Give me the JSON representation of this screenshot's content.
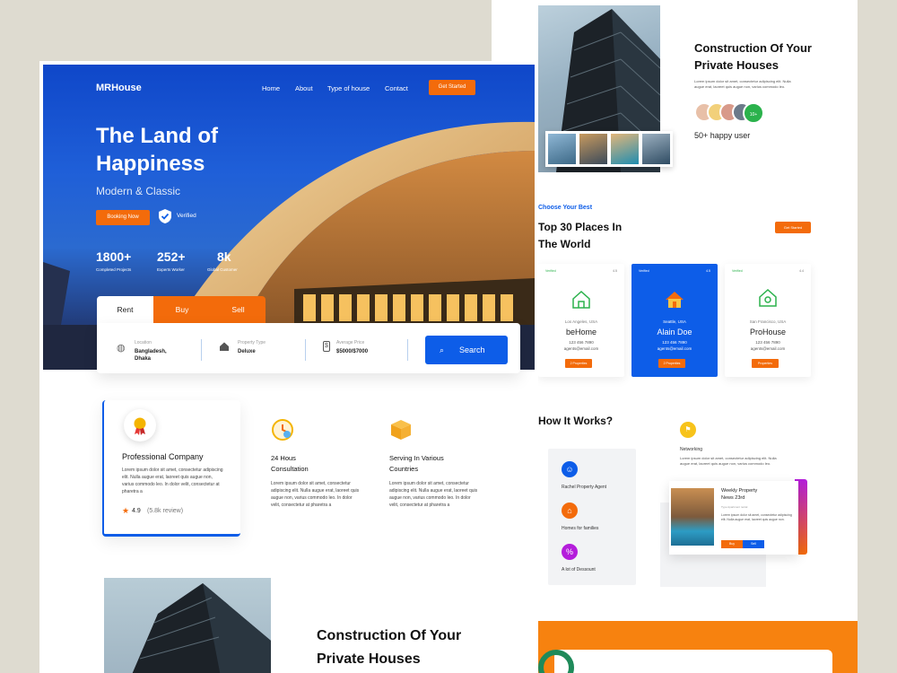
{
  "nav": {
    "logo": "MRHouse",
    "links": [
      "Home",
      "About",
      "Type of house",
      "Contact"
    ],
    "cta": "Get Started"
  },
  "hero": {
    "title_line1": "The Land of",
    "title_line2": "Happiness",
    "subtitle": "Modern & Classic",
    "booking_button": "Booking Now",
    "verified": "Verified",
    "stats": [
      {
        "value": "1800+",
        "label": "Completed Projects"
      },
      {
        "value": "252+",
        "label": "Experts Worker"
      },
      {
        "value": "8k",
        "label": "Global Customer"
      }
    ]
  },
  "search": {
    "tabs": [
      "Rent",
      "Buy",
      "Sell"
    ],
    "fields": [
      {
        "label": "Location",
        "value": "Bangladesh, Dhaka"
      },
      {
        "label": "Property Type",
        "value": "Deluxe"
      },
      {
        "label": "Average Price",
        "value": "$5000/$7000"
      }
    ],
    "button": "Search"
  },
  "features": [
    {
      "title": "Professional Company",
      "text": "Lorem ipsum dolor sit amet, consectetur adipiscing elit. Nulla augue erat, laoreet quis augue non, varius commodo leo. In dolor velit, consectetur at pharetra a",
      "rating": "4.9",
      "reviews": "(5.8k review)"
    },
    {
      "title": "24 Hous Consultation",
      "text": "Lorem ipsum dolor sit amet, consectetur adipiscing elit. Nulla augue erat, laoreet quis augue non, varius commodo leo. In dolor velit, consectetur at pharetra a"
    },
    {
      "title": "Serving In Various Countries",
      "text": "Lorem ipsum dolor sit amet, consectetur adipiscing elit. Nulla augue erat, laoreet quis augue non, varius commodo leo. In dolor velit, consectetur at pharetra a"
    }
  ],
  "construction": {
    "title_line1": "Construction Of Your",
    "title_line2": "Private Houses",
    "text": "Lorem ipsum dolor sit amet, consectetur adipiscing elit. Nulla augue erat, laoreet quis augue non, varius commodo leo.",
    "happy_badge": "10+",
    "happy_users": "50+ happy user"
  },
  "places": {
    "eyebrow": "Choose Your Best",
    "title_line1": "Top 30 Places In",
    "title_line2": "The World",
    "cta": "Get Started",
    "cards": [
      {
        "verified": "Verified",
        "rating": "4.5",
        "location": "Los Angeles, USA",
        "name": "beHome",
        "phone": "123 456 7890",
        "email": "agents@email.com",
        "button": "2 Properties"
      },
      {
        "verified": "Verified",
        "rating": "4.5",
        "location": "Seattle, USA",
        "name": "Alain Doe",
        "phone": "123 456 7890",
        "email": "agents@email.com",
        "button": "2 Properties"
      },
      {
        "verified": "Verified",
        "rating": "4.4",
        "location": "San Francisco, USA",
        "name": "ProHouse",
        "phone": "123 456 7890",
        "email": "agents@email.com",
        "button": "Properties"
      }
    ]
  },
  "how": {
    "title": "How It Works?",
    "steps": [
      "Rachel Property Agent",
      "Homes for families",
      "A lot of Dessount"
    ],
    "networking": "Networking",
    "networking_text": "Lorem ipsum dolor sit amet, consectetur adipiscing elit. Nulla augue erat, laoreet quis augue non, varius commodo leo.",
    "card": {
      "title": "Weekly Property",
      "subtitle": "News 23rd",
      "note": "Type Apartment rental",
      "text": "Lorem ipsum dolor sit amet, consectetur adipiscing elit. Nulla augue erat, laoreet quis augue non.",
      "btn1": "Buy",
      "btn2": "Sell"
    }
  },
  "colors": {
    "primary": "#0d5de8",
    "accent": "#f36b0b",
    "green": "#2bb24c"
  }
}
